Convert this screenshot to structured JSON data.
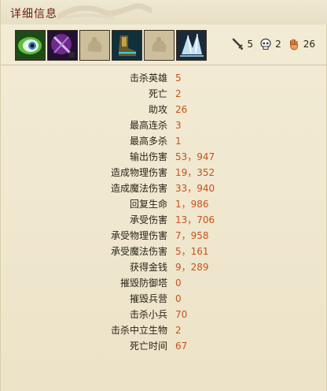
{
  "header": {
    "title": "详细信息"
  },
  "items": [
    {
      "icon": "green-eye-item-icon",
      "empty": false
    },
    {
      "icon": "purple-dagger-item-icon",
      "empty": false
    },
    {
      "icon": "empty-item-slot-icon",
      "empty": true
    },
    {
      "icon": "boots-item-icon",
      "empty": false
    },
    {
      "icon": "empty-item-slot-icon",
      "empty": true
    },
    {
      "icon": "ice-shard-item-icon",
      "empty": false
    }
  ],
  "summary": {
    "kills": "5",
    "deaths": "2",
    "assists": "26"
  },
  "stats": [
    {
      "label": "击杀英雄",
      "value": "5"
    },
    {
      "label": "死亡",
      "value": "2"
    },
    {
      "label": "助攻",
      "value": "26"
    },
    {
      "label": "最高连杀",
      "value": "3"
    },
    {
      "label": "最高多杀",
      "value": "1"
    },
    {
      "label": "输出伤害",
      "value": "53，947"
    },
    {
      "label": "造成物理伤害",
      "value": "19，352"
    },
    {
      "label": "造成魔法伤害",
      "value": "33，940"
    },
    {
      "label": "回复生命",
      "value": "1，986"
    },
    {
      "label": "承受伤害",
      "value": "13，706"
    },
    {
      "label": "承受物理伤害",
      "value": "7，958"
    },
    {
      "label": "承受魔法伤害",
      "value": "5，161"
    },
    {
      "label": "获得金钱",
      "value": "9，289"
    },
    {
      "label": "摧毁防御塔",
      "value": "0"
    },
    {
      "label": "摧毁兵营",
      "value": "0"
    },
    {
      "label": "击杀小兵",
      "value": "70"
    },
    {
      "label": "击杀中立生物",
      "value": "2"
    },
    {
      "label": "死亡时间",
      "value": "67"
    }
  ]
}
